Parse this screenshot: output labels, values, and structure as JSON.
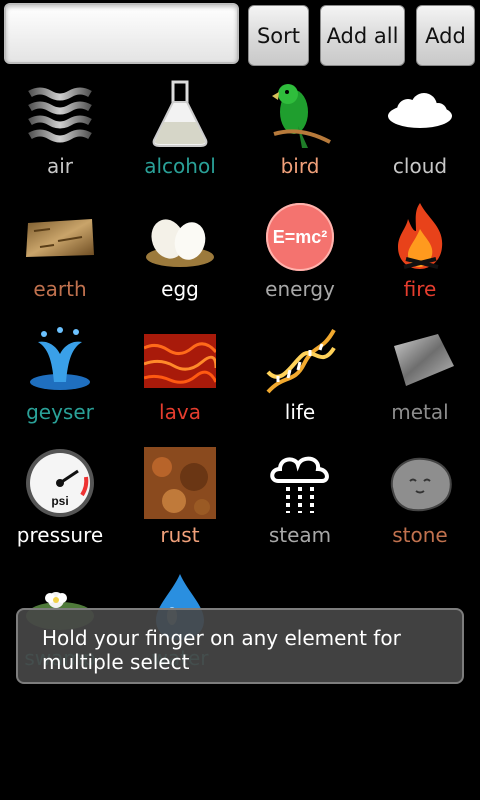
{
  "toolbar": {
    "search_value": "",
    "sort_label": "Sort",
    "add_all_label": "Add all",
    "add_label": "Add"
  },
  "elements": [
    {
      "name": "air",
      "color": "#c8c8c8",
      "icon": "air-icon"
    },
    {
      "name": "alcohol",
      "color": "#2aa198",
      "icon": "flask-icon"
    },
    {
      "name": "bird",
      "color": "#f0a07a",
      "icon": "parrot-icon"
    },
    {
      "name": "cloud",
      "color": "#c8c8c8",
      "icon": "cloud-icon"
    },
    {
      "name": "earth",
      "color": "#c0714e",
      "icon": "earth-icon"
    },
    {
      "name": "egg",
      "color": "#ffffff",
      "icon": "eggs-icon"
    },
    {
      "name": "energy",
      "color": "#a8a8a8",
      "icon": "emc2-icon"
    },
    {
      "name": "fire",
      "color": "#e53d2e",
      "icon": "fire-icon"
    },
    {
      "name": "geyser",
      "color": "#2aa198",
      "icon": "geyser-icon"
    },
    {
      "name": "lava",
      "color": "#e53d2e",
      "icon": "lava-icon"
    },
    {
      "name": "life",
      "color": "#ffffff",
      "icon": "dna-icon"
    },
    {
      "name": "metal",
      "color": "#8c8c8c",
      "icon": "metal-icon"
    },
    {
      "name": "pressure",
      "color": "#ffffff",
      "icon": "gauge-icon"
    },
    {
      "name": "rust",
      "color": "#f0a07a",
      "icon": "rust-icon"
    },
    {
      "name": "steam",
      "color": "#a8a8a8",
      "icon": "steam-icon"
    },
    {
      "name": "stone",
      "color": "#c0714e",
      "icon": "stone-icon"
    },
    {
      "name": "swamp",
      "color": "#2aa198",
      "icon": "swamp-icon"
    },
    {
      "name": "water",
      "color": "#2aa198",
      "icon": "water-drop-icon"
    }
  ],
  "toast": {
    "message": "Hold your finger on any element for multiple select"
  }
}
